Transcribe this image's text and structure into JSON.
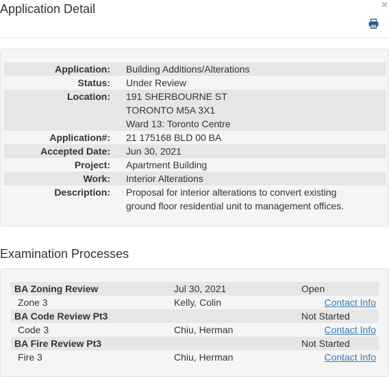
{
  "modal": {
    "title": "Application Detail",
    "close_glyph": "×"
  },
  "details": [
    {
      "label": "Application:",
      "lines": [
        "Building Additions/Alterations"
      ]
    },
    {
      "label": "Status:",
      "lines": [
        "Under Review"
      ]
    },
    {
      "label": "Location:",
      "lines": [
        "191 SHERBOURNE ST",
        "TORONTO M5A 3X1",
        "Ward 13: Toronto Centre"
      ]
    },
    {
      "label": "Application#:",
      "lines": [
        "21 175168 BLD 00 BA"
      ]
    },
    {
      "label": "Accepted Date:",
      "lines": [
        "Jun 30, 2021"
      ]
    },
    {
      "label": "Project:",
      "lines": [
        "Apartment Building"
      ]
    },
    {
      "label": "Work:",
      "lines": [
        "Interior Alterations"
      ]
    },
    {
      "label": "Description:",
      "lines": [
        "Proposal for interior alterations to convert existing",
        "ground floor residential unit to management offices."
      ]
    }
  ],
  "examination": {
    "title": "Examination Processes",
    "processes": [
      {
        "name": "BA Zoning Review",
        "date": "Jul 30, 2021",
        "status": "Open",
        "sub": {
          "code": "Zone 3",
          "examiner": "Kelly, Colin",
          "link": "Contact Info"
        }
      },
      {
        "name": "BA Code Review Pt3",
        "date": "",
        "status": "Not Started",
        "sub": {
          "code": "Code 3",
          "examiner": "Chiu, Herman",
          "link": "Contact Info"
        }
      },
      {
        "name": "BA Fire Review Pt3",
        "date": "",
        "status": "Not Started",
        "sub": {
          "code": "Fire 3",
          "examiner": "Chiu, Herman",
          "link": "Contact Info"
        }
      }
    ]
  },
  "icons": {
    "print": "print-icon",
    "close": "close-icon"
  },
  "colors": {
    "link": "#337ab7",
    "panel_bg": "#f5f5f5",
    "row_shade": "#e6e6e6"
  }
}
